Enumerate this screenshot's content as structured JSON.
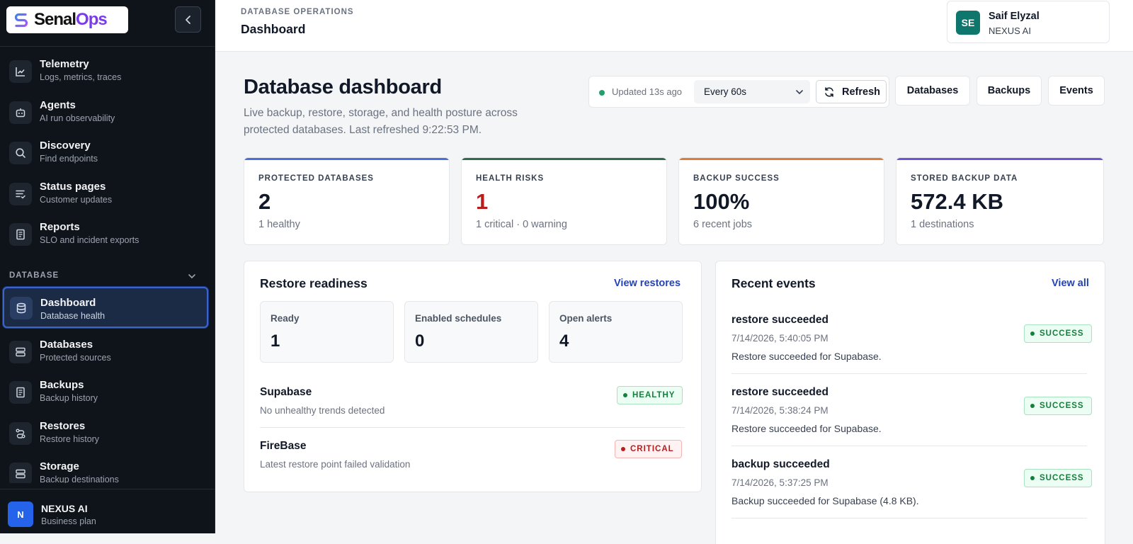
{
  "brand": {
    "name_a": "Senal",
    "name_b": "Ops",
    "accent": "#7c3aed"
  },
  "sidebar": {
    "items": [
      {
        "title": "Telemetry",
        "sub": "Logs, metrics, traces",
        "icon": "chart-line-icon"
      },
      {
        "title": "Agents",
        "sub": "AI run observability",
        "icon": "bot-icon"
      },
      {
        "title": "Discovery",
        "sub": "Find endpoints",
        "icon": "search-icon"
      },
      {
        "title": "Status pages",
        "sub": "Customer updates",
        "icon": "list-check-icon"
      },
      {
        "title": "Reports",
        "sub": "SLO and incident exports",
        "icon": "document-icon"
      }
    ],
    "section_label": "DATABASE",
    "db_items": [
      {
        "title": "Dashboard",
        "sub": "Database health",
        "icon": "database-icon",
        "active": true
      },
      {
        "title": "Databases",
        "sub": "Protected sources",
        "icon": "server-icon"
      },
      {
        "title": "Backups",
        "sub": "Backup history",
        "icon": "document-icon"
      },
      {
        "title": "Restores",
        "sub": "Restore history",
        "icon": "restore-icon"
      },
      {
        "title": "Storage",
        "sub": "Backup destinations",
        "icon": "server-icon"
      }
    ],
    "org": {
      "initial": "N",
      "name": "NEXUS AI",
      "plan": "Business plan"
    }
  },
  "header": {
    "eyebrow": "DATABASE OPERATIONS",
    "title": "Dashboard",
    "user": {
      "initials": "SE",
      "name": "Saif Elyzal",
      "org": "NEXUS AI"
    }
  },
  "main": {
    "title": "Database dashboard",
    "subtitle": "Live backup, restore, storage, and health posture across protected databases. Last refreshed 9:22:53 PM.",
    "toolbar": {
      "updated": "Updated 13s ago",
      "interval": "Every 60s",
      "refresh": "Refresh"
    },
    "buttons": {
      "databases": "Databases",
      "backups": "Backups",
      "events": "Events"
    },
    "stats": [
      {
        "label": "PROTECTED DATABASES",
        "value": "2",
        "note": "1 healthy",
        "color": "#4a6fdc"
      },
      {
        "label": "HEALTH RISKS",
        "value": "1",
        "note": "1 critical · 0 warning",
        "color": "#2f6b4f",
        "value_color": "#b91c1c"
      },
      {
        "label": "BACKUP SUCCESS",
        "value": "100%",
        "note": "6 recent jobs",
        "color": "#e07b3c"
      },
      {
        "label": "STORED BACKUP DATA",
        "value": "572.4 KB",
        "note": "1 destinations",
        "color": "#6d54d6"
      }
    ],
    "restore": {
      "title": "Restore readiness",
      "link": "View restores",
      "metrics": [
        {
          "label": "Ready",
          "value": "1"
        },
        {
          "label": "Enabled schedules",
          "value": "0"
        },
        {
          "label": "Open alerts",
          "value": "4"
        }
      ],
      "databases": [
        {
          "name": "Supabase",
          "desc": "No unhealthy trends detected",
          "status": "HEALTHY"
        },
        {
          "name": "FireBase",
          "desc": "Latest restore point failed validation",
          "status": "CRITICAL"
        }
      ]
    },
    "events": {
      "title": "Recent events",
      "link": "View all",
      "items": [
        {
          "title": "restore succeeded",
          "time": "7/14/2026, 5:40:05 PM",
          "desc": "Restore succeeded for Supabase.",
          "status": "SUCCESS"
        },
        {
          "title": "restore succeeded",
          "time": "7/14/2026, 5:38:24 PM",
          "desc": "Restore succeeded for Supabase.",
          "status": "SUCCESS"
        },
        {
          "title": "backup succeeded",
          "time": "7/14/2026, 5:37:25 PM",
          "desc": "Backup succeeded for Supabase (4.8 KB).",
          "status": "SUCCESS"
        }
      ]
    }
  }
}
